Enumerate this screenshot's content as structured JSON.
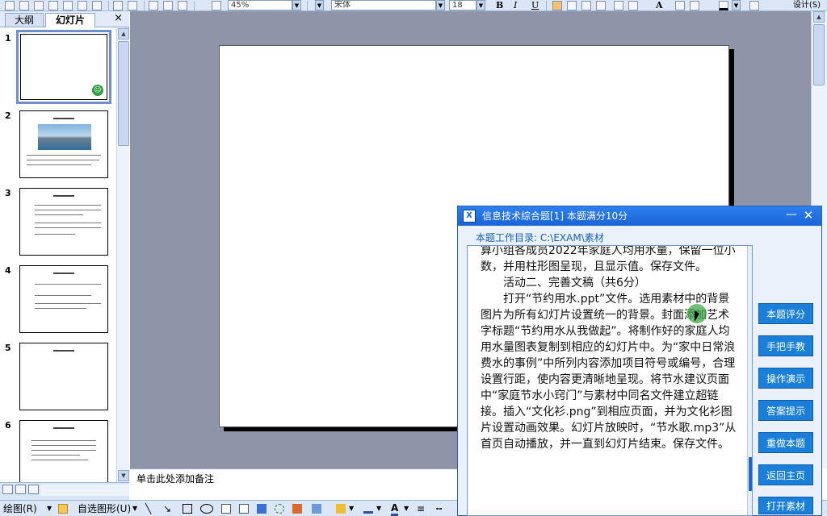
{
  "toolbar": {
    "zoom_value": "45%",
    "font_name": "宋体",
    "font_size": "18",
    "design_label": "设计(S)"
  },
  "left_pane": {
    "tabs": [
      {
        "label": "大纲",
        "active": false
      },
      {
        "label": "幻灯片",
        "active": true
      }
    ],
    "close_label": "×",
    "slides": [
      {
        "number": "1",
        "selected": true
      },
      {
        "number": "2",
        "selected": false
      },
      {
        "number": "3",
        "selected": false
      },
      {
        "number": "4",
        "selected": false
      },
      {
        "number": "5",
        "selected": false
      },
      {
        "number": "6",
        "selected": false
      }
    ]
  },
  "notes": {
    "placeholder": "单击此处添加备注"
  },
  "draw_bar": {
    "draw_label": "绘图(R)",
    "autoshape_label": "自选图形(U)"
  },
  "dialog": {
    "title": "信息技术综合题[1]    本题满分10分",
    "min_label": "—",
    "close_label": "✕",
    "work_dir": "本题工作目录: C:\\EXAM\\素材",
    "paragraphs": [
      {
        "text": "算小组各成员2022年家庭人均用水量，保留一位小数，并用柱形图呈现，且显示值。保存文件。",
        "indent": false
      },
      {
        "text": "活动二、完善文稿（共6分）",
        "indent": true
      },
      {
        "text": "打开“节约用水.ppt”文件。选用素材中的背景图片为所有幻灯片设置统一的背景。封面添加艺术字标题“节约用水从我做起”。将制作好的家庭人均用水量图表复制到相应的幻灯片中。为“家中日常浪费水的事例”中所列内容添加项目符号或编号，合理设置行距，使内容更清晰地呈现。将节水建议页面中“家庭节水小窍门”与素材中同名文件建立超链接。插入“文化衫.png”到相应页面，并为文化衫图片设置动画效果。幻灯片放映时，“节水歌.mp3”从首页自动播放，并一直到幻灯片结束。保存文件。",
        "indent": true
      }
    ],
    "buttons": [
      "本题评分",
      "手把手教",
      "操作演示",
      "答案提示",
      "重做本题",
      "返回主页",
      "打开素材"
    ]
  },
  "colors": {
    "dialog_title": "#1a64d6",
    "dialog_button": "#1a7fd8",
    "canvas_bg": "#8f95a8"
  }
}
